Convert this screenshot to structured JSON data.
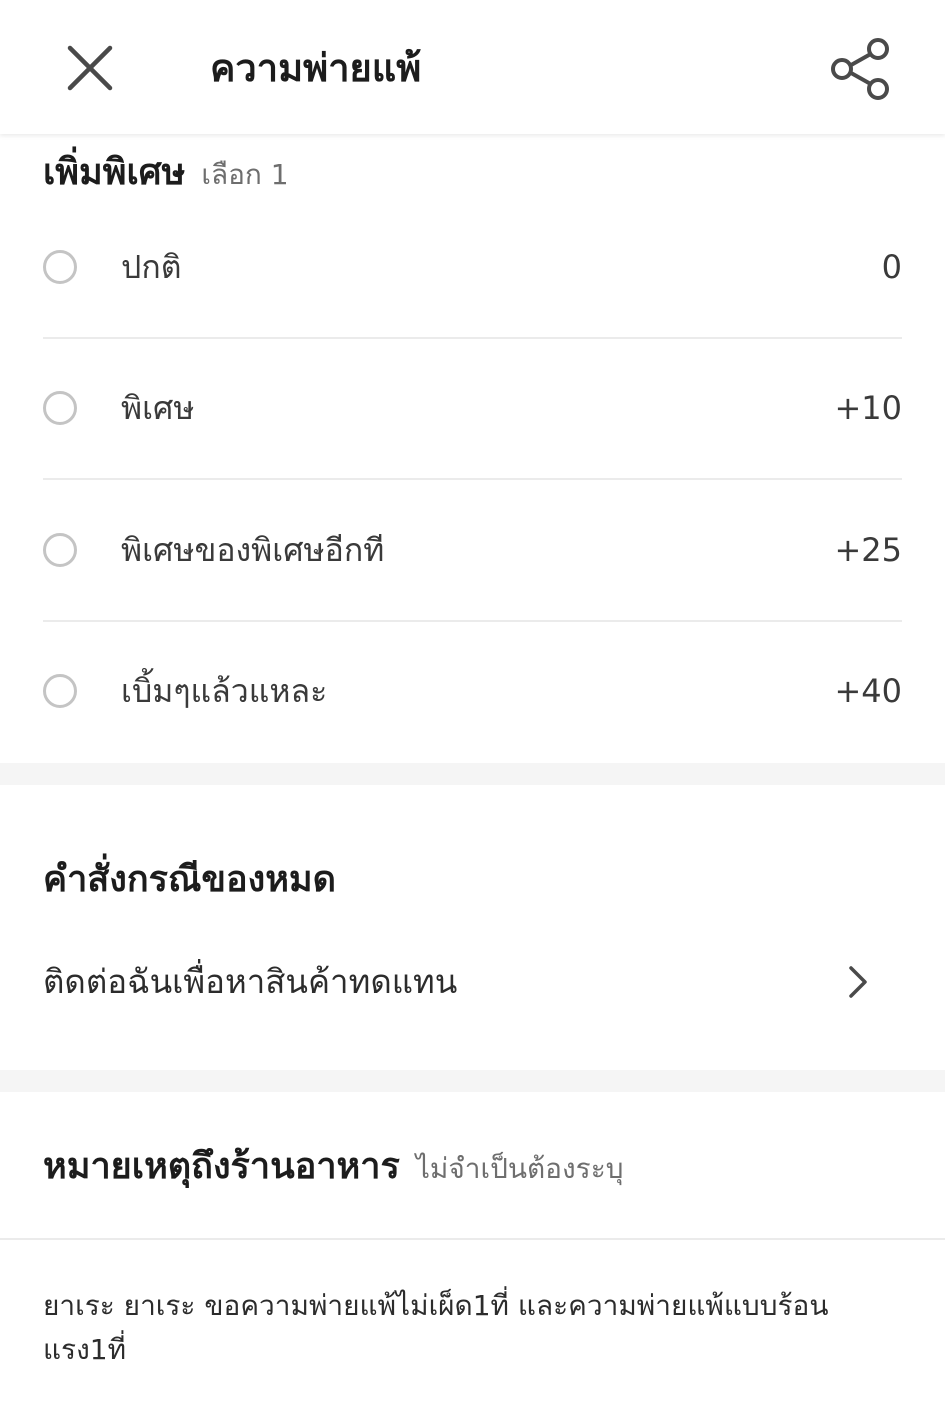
{
  "header": {
    "title": "ความพ่ายแพ้",
    "close_icon": "close-icon",
    "share_icon": "share-icon"
  },
  "extra_section": {
    "title": "เพิ่มพิเศษ",
    "subtitle": "เลือก 1",
    "options": [
      {
        "label": "ปกติ",
        "price": "0"
      },
      {
        "label": "พิเศษ",
        "price": "+10"
      },
      {
        "label": "พิเศษของพิเศษอีกที",
        "price": "+25"
      },
      {
        "label": "เบิ้มๆแล้วแหละ",
        "price": "+40"
      }
    ]
  },
  "out_of_stock": {
    "title": "คำสั่งกรณีของหมด",
    "selected": "ติดต่อฉันเพื่อหาสินค้าทดแทน",
    "chevron_icon": "chevron-right-icon"
  },
  "note_section": {
    "title": "หมายเหตุถึงร้านอาหาร",
    "subtitle": "ไม่จำเป็นต้องระบุ",
    "text": "ยาเระ ยาเระ ขอความพ่ายแพ้ไม่เผ็ด1ที่ และความพ่ายแพ้แบบร้อนแรง1ที่"
  },
  "colors": {
    "text_primary": "#1c1c1c",
    "text_secondary": "#6e6e6e",
    "radio_border": "#c4c4c4",
    "divider": "#ebebeb",
    "section_gap": "#f5f5f5"
  }
}
